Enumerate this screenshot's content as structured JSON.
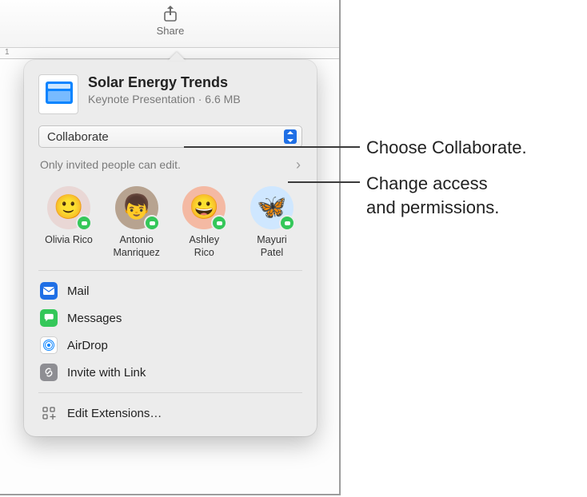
{
  "toolbar": {
    "share_label": "Share"
  },
  "document": {
    "title": "Solar Energy Trends",
    "subtitle": "Keynote Presentation · 6.6 MB"
  },
  "mode": {
    "label": "Collaborate"
  },
  "permissions": {
    "summary": "Only invited people can edit."
  },
  "contacts": [
    {
      "name_line1": "Olivia Rico",
      "name_line2": "",
      "bg": "#e9d7d5",
      "emoji": "🙂"
    },
    {
      "name_line1": "Antonio",
      "name_line2": "Manriquez",
      "bg": "#b7a390",
      "emoji": "👦"
    },
    {
      "name_line1": "Ashley",
      "name_line2": "Rico",
      "bg": "#f4b9a3",
      "emoji": "😀"
    },
    {
      "name_line1": "Mayuri",
      "name_line2": "Patel",
      "bg": "#cfe7ff",
      "emoji": "🦋"
    }
  ],
  "actions": {
    "mail": "Mail",
    "messages": "Messages",
    "airdrop": "AirDrop",
    "invite": "Invite with Link"
  },
  "extensions": {
    "edit": "Edit Extensions…"
  },
  "callouts": {
    "collaborate": "Choose Collaborate.",
    "permissions_line1": "Change access",
    "permissions_line2": "and permissions."
  }
}
